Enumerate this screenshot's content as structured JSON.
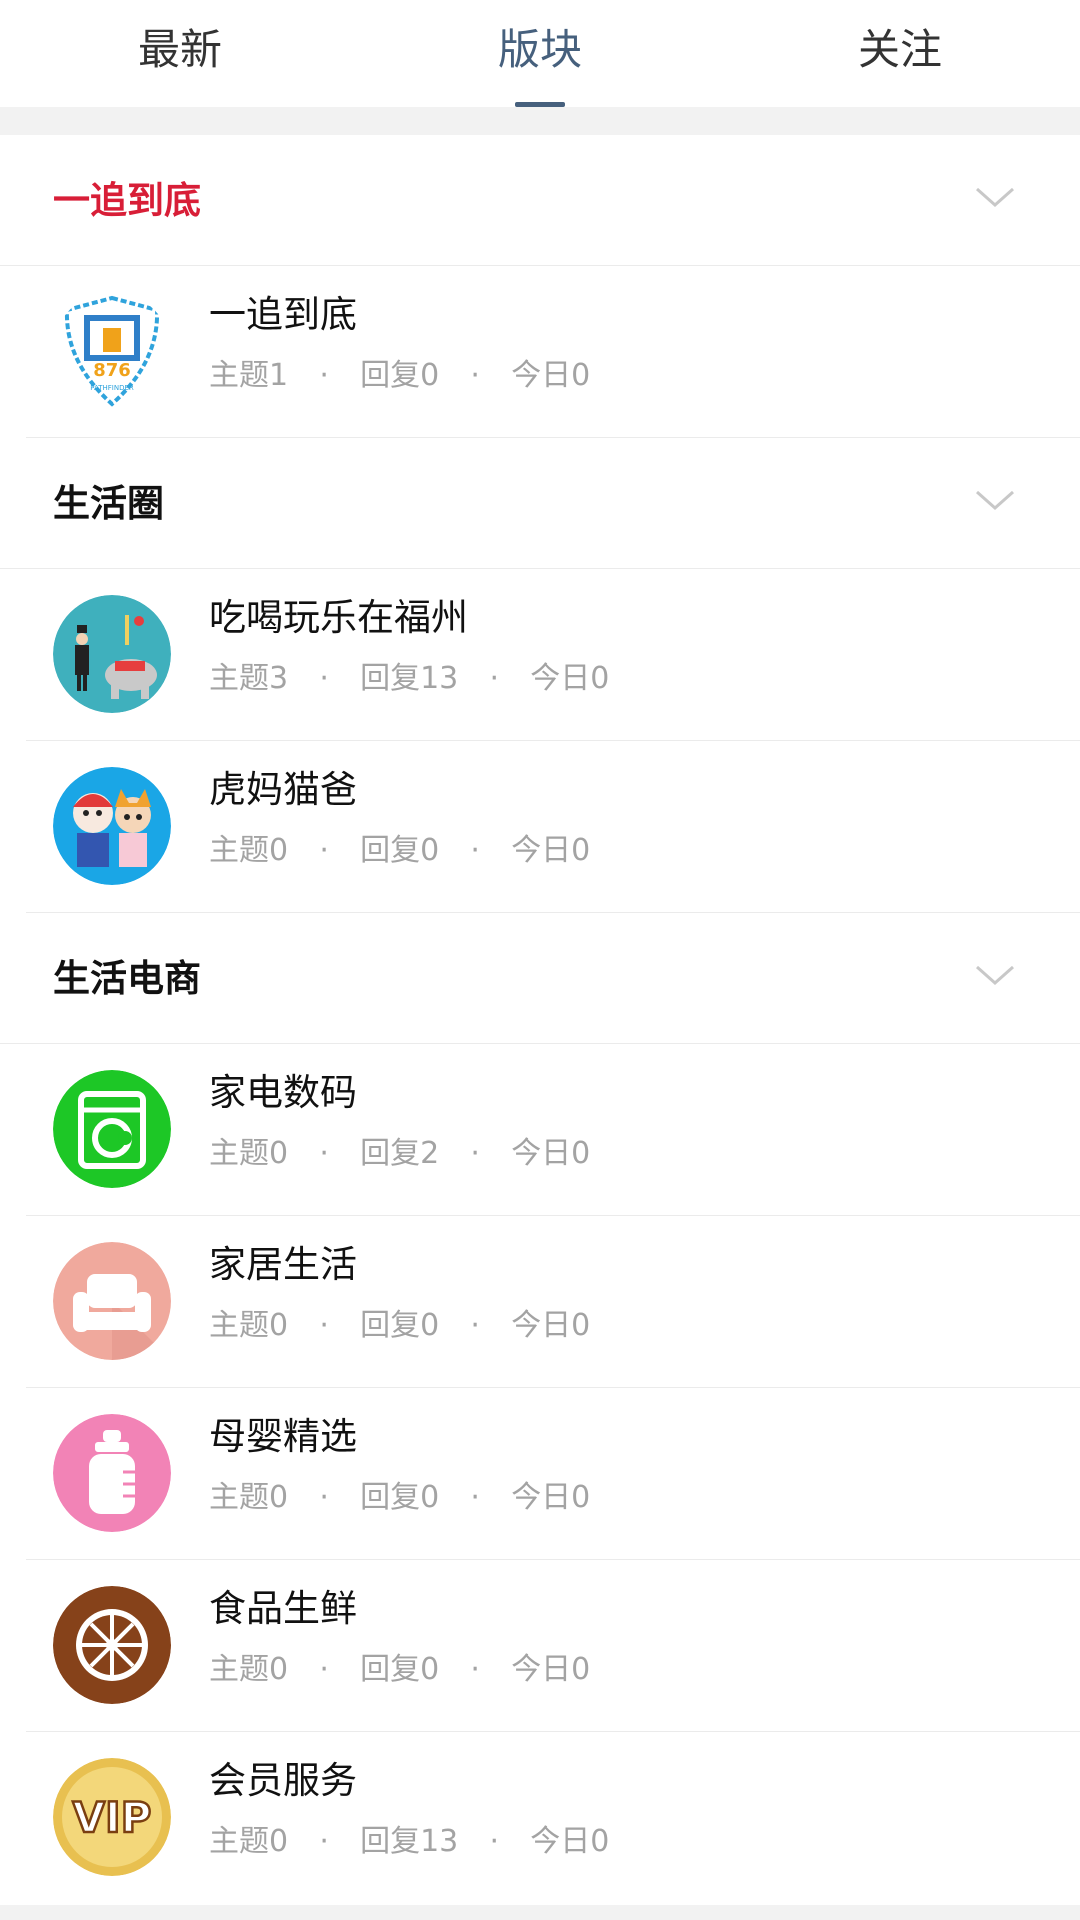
{
  "tabs": [
    {
      "label": "最新",
      "active": false
    },
    {
      "label": "版块",
      "active": true
    },
    {
      "label": "关注",
      "active": false
    }
  ],
  "sections": [
    {
      "title": "一追到底",
      "highlight": true,
      "forums": [
        {
          "name": "一追到底",
          "topics": "主题1",
          "replies": "回复0",
          "today": "今日0",
          "icon": "explore-876-badge"
        }
      ]
    },
    {
      "title": "生活圈",
      "highlight": false,
      "forums": [
        {
          "name": "吃喝玩乐在福州",
          "topics": "主题3",
          "replies": "回复13",
          "today": "今日0",
          "icon": "circus-elephant-icon"
        },
        {
          "name": "虎妈猫爸",
          "topics": "主题0",
          "replies": "回复0",
          "today": "今日0",
          "icon": "family-cartoon-icon"
        }
      ]
    },
    {
      "title": "生活电商",
      "highlight": false,
      "forums": [
        {
          "name": "家电数码",
          "topics": "主题0",
          "replies": "回复2",
          "today": "今日0",
          "icon": "washing-machine-icon"
        },
        {
          "name": "家居生活",
          "topics": "主题0",
          "replies": "回复0",
          "today": "今日0",
          "icon": "sofa-icon"
        },
        {
          "name": "母婴精选",
          "topics": "主题0",
          "replies": "回复0",
          "today": "今日0",
          "icon": "baby-bottle-icon"
        },
        {
          "name": "食品生鲜",
          "topics": "主题0",
          "replies": "回复0",
          "today": "今日0",
          "icon": "orange-slice-icon"
        },
        {
          "name": "会员服务",
          "topics": "主题0",
          "replies": "回复13",
          "today": "今日0",
          "icon": "vip-badge-icon"
        }
      ]
    }
  ],
  "separator": "·",
  "colors": {
    "accent": "#46607d",
    "highlight": "#d81e37",
    "muted": "#a3a3a3"
  }
}
